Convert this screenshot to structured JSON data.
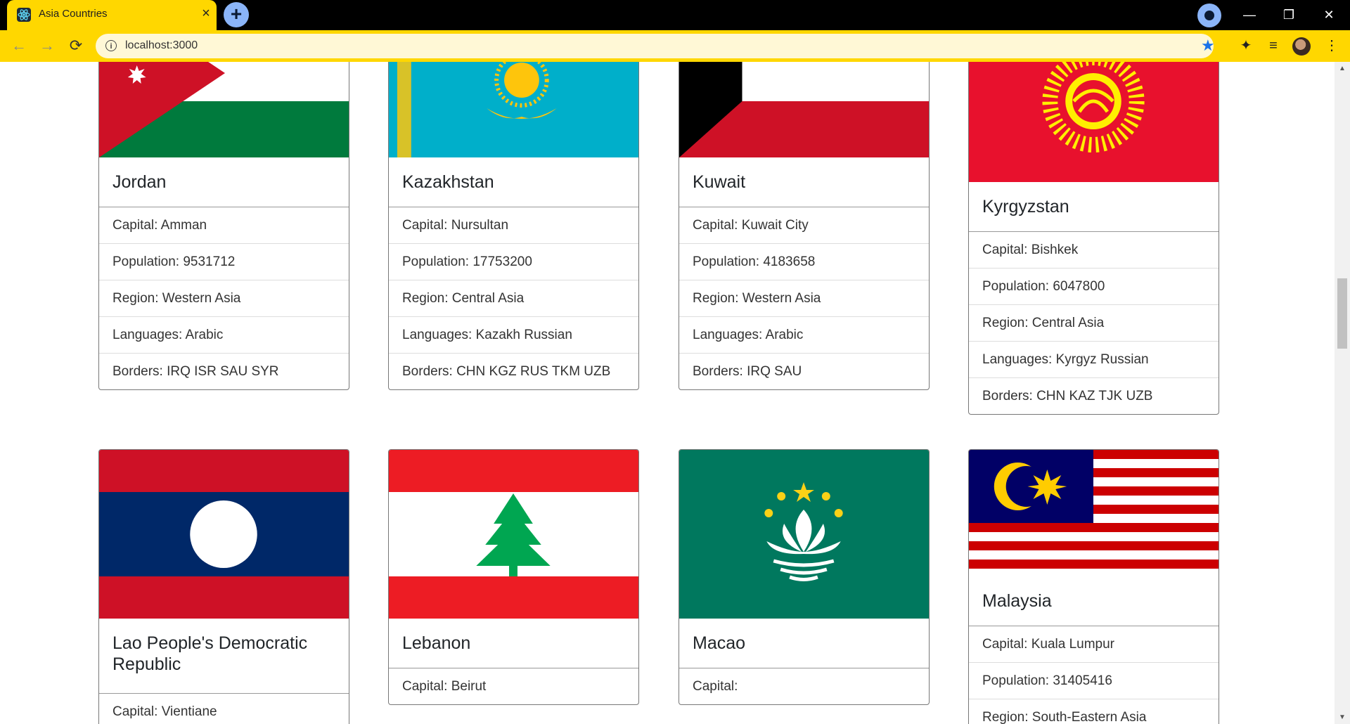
{
  "browser": {
    "tab_title": "Asia Countries",
    "tab_close": "×",
    "new_tab": "+",
    "url": "localhost:3000",
    "window_minimize": "—",
    "window_restore": "❐",
    "window_close": "✕",
    "back": "←",
    "forward": "→",
    "reload": "⟳",
    "star": "★",
    "extensions": "✦",
    "media": "≡",
    "menu": "⋮",
    "info": "i"
  },
  "colors": {
    "chrome_accent": "#ffd700",
    "tabstrip": "#000000",
    "star": "#1a73e8"
  },
  "cards": [
    {
      "name": "Jordan",
      "capital": "Capital: Amman",
      "population": "Population: 9531712",
      "region": "Region: Western Asia",
      "languages": "Languages: Arabic",
      "borders": "Borders: IRQ ISR SAU SYR",
      "flag_icon": "jordan-flag"
    },
    {
      "name": "Kazakhstan",
      "capital": "Capital: Nursultan",
      "population": "Population: 17753200",
      "region": "Region: Central Asia",
      "languages": "Languages: Kazakh Russian",
      "borders": "Borders: CHN KGZ RUS TKM UZB",
      "flag_icon": "kazakhstan-flag"
    },
    {
      "name": "Kuwait",
      "capital": "Capital: Kuwait City",
      "population": "Population: 4183658",
      "region": "Region: Western Asia",
      "languages": "Languages: Arabic",
      "borders": "Borders: IRQ SAU",
      "flag_icon": "kuwait-flag"
    },
    {
      "name": "Kyrgyzstan",
      "capital": "Capital: Bishkek",
      "population": "Population: 6047800",
      "region": "Region: Central Asia",
      "languages": "Languages: Kyrgyz Russian",
      "borders": "Borders: CHN KAZ TJK UZB",
      "flag_icon": "kyrgyzstan-flag"
    },
    {
      "name": "Lao People's Democratic Republic",
      "capital": "Capital: Vientiane",
      "flag_icon": "laos-flag"
    },
    {
      "name": "Lebanon",
      "capital": "Capital: Beirut",
      "flag_icon": "lebanon-flag"
    },
    {
      "name": "Macao",
      "capital": "Capital:",
      "flag_icon": "macao-flag"
    },
    {
      "name": "Malaysia",
      "capital": "Capital: Kuala Lumpur",
      "population": "Population: 31405416",
      "region": "Region: South-Eastern Asia",
      "flag_icon": "malaysia-flag"
    }
  ]
}
